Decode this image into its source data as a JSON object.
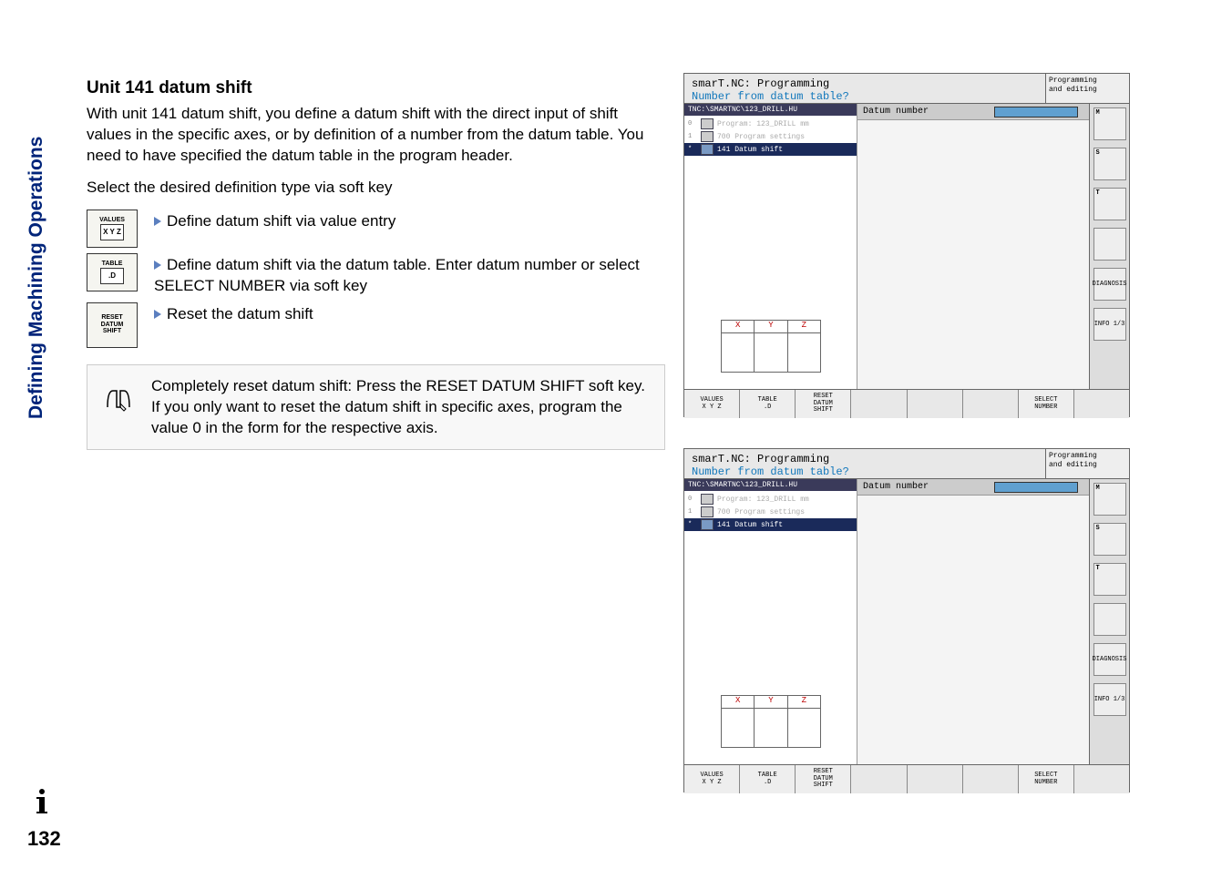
{
  "page_number": "132",
  "side_label": "Defining Machining Operations",
  "heading": "Unit 141 datum shift",
  "para1": "With unit 141 datum shift, you define a datum shift with the direct input of shift values in the specific axes, or by definition of a number from the datum table. You need to have specified the datum table in the program header.",
  "para2": "Select the desired definition type via soft key",
  "defs": [
    {
      "label_top": "VALUES",
      "label_bot": "X Y Z",
      "text": "Define datum shift via value entry"
    },
    {
      "label_top": "TABLE",
      "label_bot": ".D",
      "text": "Define datum shift via the datum table. Enter datum number or select SELECT NUMBER via soft key"
    },
    {
      "label_top": "RESET",
      "label_mid": "DATUM",
      "label_bot": "SHIFT",
      "text": "Reset the datum shift"
    }
  ],
  "note": "Completely reset datum shift: Press the RESET DATUM SHIFT soft key. If you only want to reset the datum shift in specific axes, program the value 0 in the form for the respective axis.",
  "ss": {
    "title_line1": "smarT.NC: Programming",
    "title_line2": "Number from datum table?",
    "mode_line1": "Programming",
    "mode_line2": "and editing",
    "path": "TNC:\\SMARTNC\\123_DRILL.HU",
    "tree": [
      {
        "idx": "0",
        "text": "Program: 123_DRILL mm",
        "grey": true
      },
      {
        "idx": "1",
        "text": "700 Program settings",
        "grey": true
      },
      {
        "idx": "*",
        "text": "141 Datum shift",
        "grey": false,
        "sel": true
      }
    ],
    "mid_label": "Datum number",
    "input_val": "",
    "xyz": [
      "X",
      "Y",
      "Z"
    ],
    "right": [
      {
        "l": "M"
      },
      {
        "l": "S"
      },
      {
        "l": "T"
      },
      {
        "l": ""
      },
      {
        "l": "DIAGNOSIS"
      },
      {
        "l": "INFO 1/3"
      }
    ],
    "softkeys": [
      {
        "t1": "VALUES",
        "t2": "X Y Z"
      },
      {
        "t1": "TABLE",
        "t2": ".D"
      },
      {
        "t1": "RESET",
        "t2": "DATUM",
        "t3": "SHIFT"
      },
      {
        "t1": "",
        "t2": ""
      },
      {
        "t1": "",
        "t2": ""
      },
      {
        "t1": "",
        "t2": ""
      },
      {
        "t1": "SELECT",
        "t2": "NUMBER"
      },
      {
        "t1": "",
        "t2": ""
      }
    ]
  }
}
